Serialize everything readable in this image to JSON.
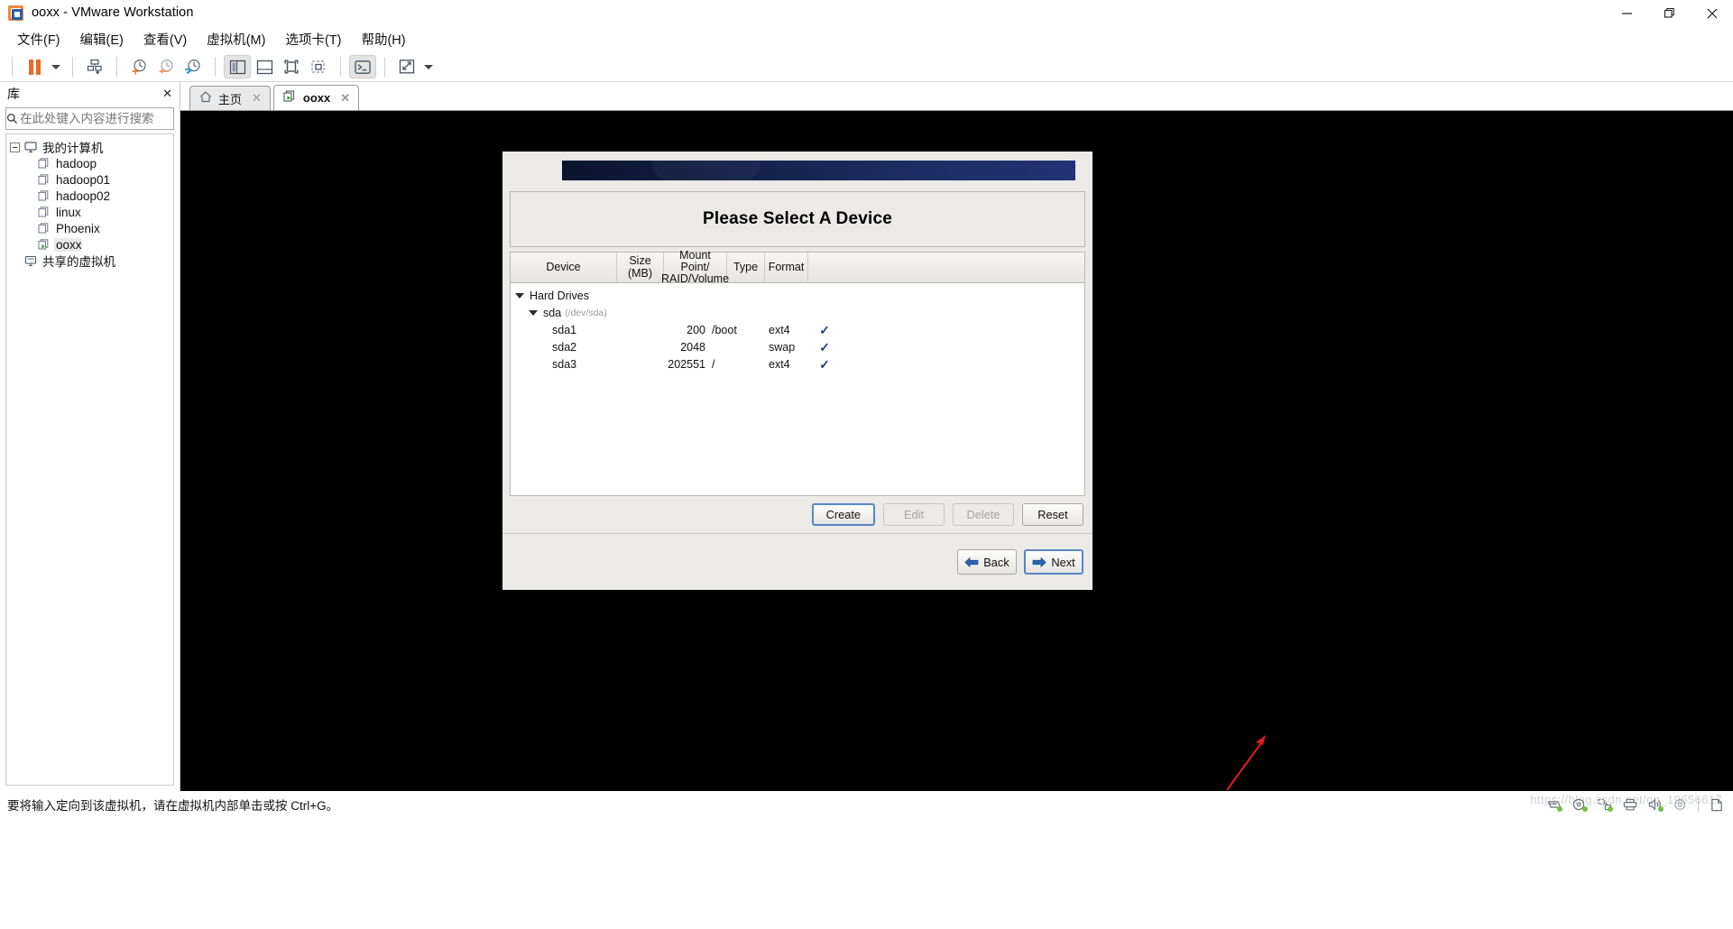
{
  "window": {
    "title": "ooxx - VMware Workstation",
    "logo_icon": "vmware-logo-icon",
    "controls": [
      {
        "name": "minimize",
        "icon": "minimize-icon"
      },
      {
        "name": "maximize",
        "icon": "restore-icon"
      },
      {
        "name": "close",
        "icon": "close-icon"
      }
    ]
  },
  "menubar": {
    "items": [
      {
        "label": "文件(F)",
        "text": "文件(",
        "accel": "F",
        "tail": ")"
      },
      {
        "label": "编辑(E)",
        "text": "编辑(",
        "accel": "E",
        "tail": ")"
      },
      {
        "label": "查看(V)",
        "text": "查看(",
        "accel": "V",
        "tail": ")"
      },
      {
        "label": "虚拟机(M)",
        "text": "虚拟机(",
        "accel": "M",
        "tail": ")"
      },
      {
        "label": "选项卡(T)",
        "text": "选项卡(",
        "accel": "T",
        "tail": ")"
      },
      {
        "label": "帮助(H)",
        "text": "帮助(",
        "accel": "H",
        "tail": ")"
      }
    ]
  },
  "toolbar": {
    "buttons": [
      {
        "name": "suspend-button",
        "icon": "pause-icon"
      },
      {
        "name": "power-dropdown",
        "icon": "chevron-down-icon"
      },
      {
        "name": "manage-snapshot-button",
        "icon": "snapshot-manager-icon"
      },
      {
        "name": "take-snapshot-button",
        "icon": "snapshot-add-icon"
      },
      {
        "name": "revert-snapshot-button",
        "icon": "snapshot-revert-icon"
      },
      {
        "name": "snapshot-manager-button",
        "icon": "snapshot-wrench-icon"
      },
      {
        "name": "show-library-button",
        "icon": "panel-left-icon"
      },
      {
        "name": "show-thumbnail-bar-button",
        "icon": "panel-bottom-icon"
      },
      {
        "name": "show-console-view-button",
        "icon": "console-view-icon"
      },
      {
        "name": "unity-mode-button",
        "icon": "unity-mode-icon"
      },
      {
        "name": "send-ctrl-alt-del-button",
        "icon": "terminal-icon"
      },
      {
        "name": "fullscreen-button",
        "icon": "fullscreen-icon"
      },
      {
        "name": "fullscreen-dropdown",
        "icon": "chevron-down-icon"
      }
    ]
  },
  "sidebar": {
    "header": "库",
    "close_icon": "close-icon",
    "search": {
      "placeholder": "在此处键入内容进行搜索",
      "value": "",
      "icon": "search-icon",
      "dropdown_icon": "chevron-down-icon"
    },
    "tree": {
      "root": {
        "label": "我的计算机",
        "icon": "computer-icon",
        "expanded": true
      },
      "vms": [
        {
          "label": "hadoop",
          "icon": "vm-icon",
          "running": false
        },
        {
          "label": "hadoop01",
          "icon": "vm-icon",
          "running": false
        },
        {
          "label": "hadoop02",
          "icon": "vm-icon",
          "running": false
        },
        {
          "label": "linux",
          "icon": "vm-icon",
          "running": false
        },
        {
          "label": "Phoenix",
          "icon": "vm-icon",
          "running": false
        },
        {
          "label": "ooxx",
          "icon": "vm-running-icon",
          "running": true
        }
      ],
      "shared": {
        "label": "共享的虚拟机",
        "icon": "shared-vm-icon"
      }
    }
  },
  "tabs": [
    {
      "label": "主页",
      "icon": "home-icon",
      "active": false,
      "close_icon": "close-icon"
    },
    {
      "label": "ooxx",
      "icon": "vm-running-icon",
      "active": true,
      "close_icon": "close-icon"
    }
  ],
  "installer": {
    "banner_colors": {
      "left": "#0b142c",
      "right": "#223274"
    },
    "title": "Please Select A Device",
    "table": {
      "headers": [
        {
          "label": "Device"
        },
        {
          "label": "Size\n(MB)",
          "line1": "Size",
          "line2": "(MB)"
        },
        {
          "label": "Mount Point/\nRAID/Volume",
          "line1": "Mount Point/",
          "line2": "RAID/Volume"
        },
        {
          "label": "Type"
        },
        {
          "label": "Format"
        }
      ],
      "rows": [
        {
          "indent": 0,
          "expander": true,
          "device": "Hard Drives",
          "path": "",
          "size": "",
          "mount": "",
          "type": "",
          "format": false
        },
        {
          "indent": 1,
          "expander": true,
          "device": "sda",
          "path": "(/dev/sda)",
          "size": "",
          "mount": "",
          "type": "",
          "format": false
        },
        {
          "indent": 2,
          "expander": false,
          "device": "sda1",
          "path": "",
          "size": "200",
          "mount": "/boot",
          "type": "ext4",
          "format": true
        },
        {
          "indent": 2,
          "expander": false,
          "device": "sda2",
          "path": "",
          "size": "2048",
          "mount": "",
          "type": "swap",
          "format": true
        },
        {
          "indent": 2,
          "expander": false,
          "device": "sda3",
          "path": "",
          "size": "202551",
          "mount": "/",
          "type": "ext4",
          "format": true
        }
      ],
      "format_check_glyph": "✓",
      "check_color": "#16408c"
    },
    "actions": [
      {
        "label": "Create",
        "state": "default",
        "focused": true
      },
      {
        "label": "Edit",
        "state": "disabled",
        "focused": false
      },
      {
        "label": "Delete",
        "state": "disabled",
        "focused": false
      },
      {
        "label": "Reset",
        "state": "default",
        "focused": false
      }
    ],
    "nav": [
      {
        "label": "Back",
        "icon": "arrow-left-icon",
        "focused": false
      },
      {
        "label": "Next",
        "icon": "arrow-right-icon",
        "focused": true
      }
    ],
    "annotation": {
      "type": "red-arrow",
      "color": "#e01b24",
      "points_to": "Next"
    }
  },
  "statusbar": {
    "message": "要将输入定向到该虚拟机，请在虚拟机内部单击或按 Ctrl+G。",
    "watermark": "https://blog.csdn.net/qq_19656617",
    "icons": [
      {
        "name": "hard-disk-icon"
      },
      {
        "name": "cdrom-icon"
      },
      {
        "name": "network-icon"
      },
      {
        "name": "printer-icon"
      },
      {
        "name": "sound-icon"
      },
      {
        "name": "usb-icon"
      },
      {
        "name": "message-log-icon"
      }
    ]
  }
}
